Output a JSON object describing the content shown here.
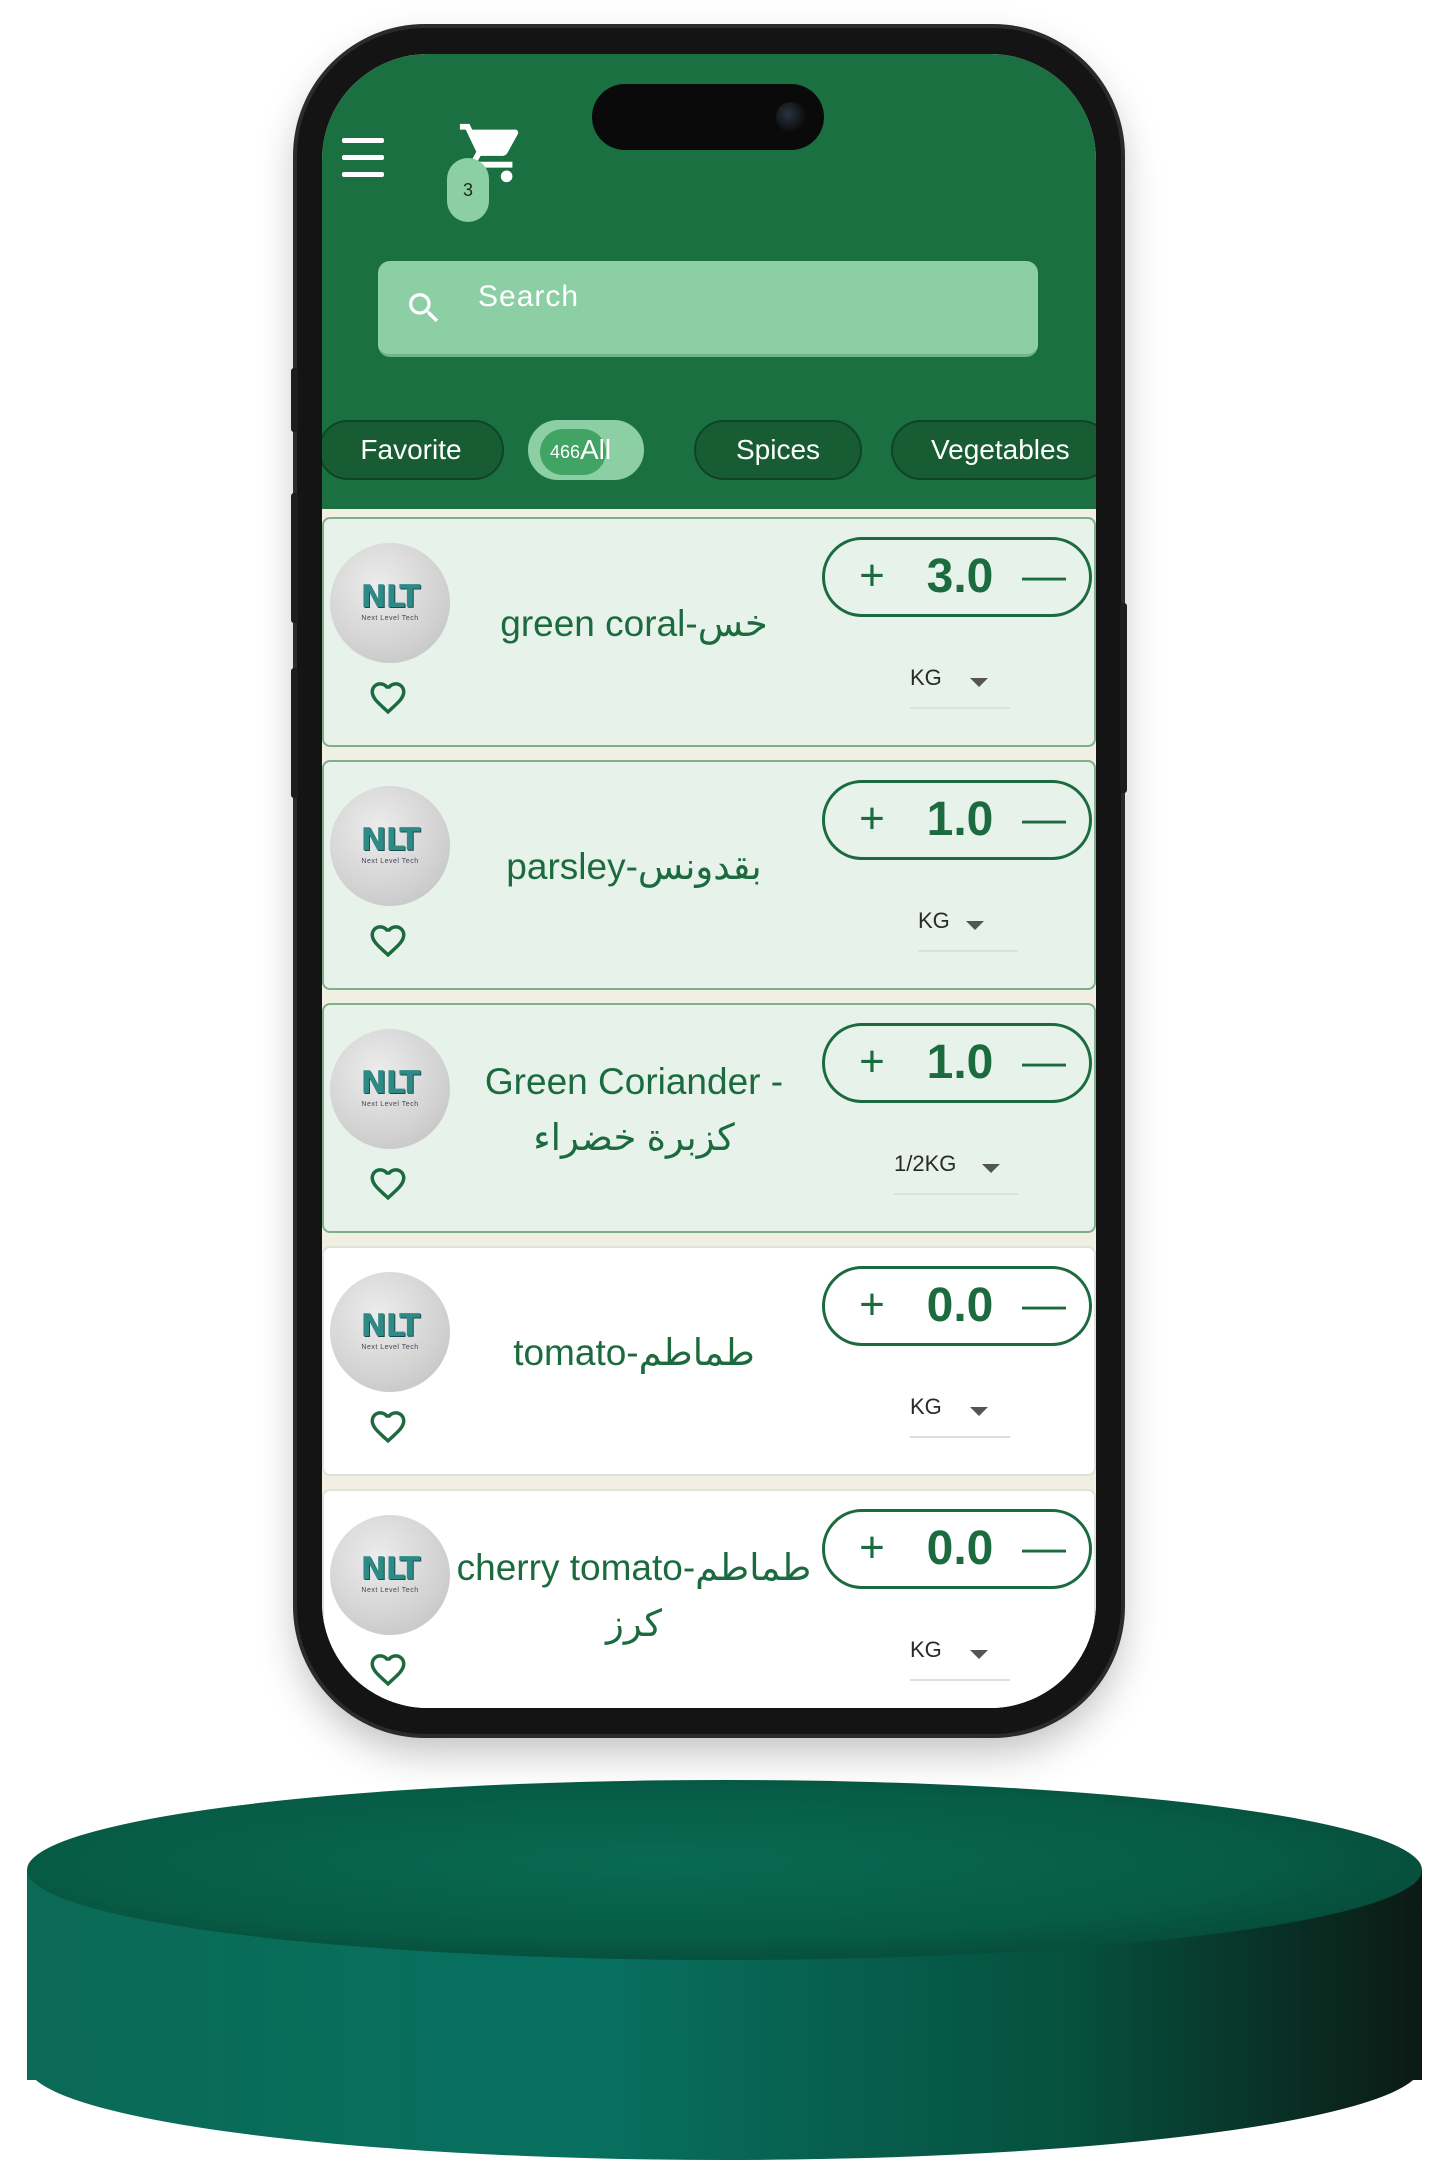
{
  "header": {
    "menu_icon": "hamburger-menu-icon",
    "cart_icon": "shopping-cart-icon",
    "cart_count": "3",
    "colors": {
      "header_bg": "#1a7040",
      "accent_light": "#8dcfa5",
      "text_green": "#1c6b3e"
    }
  },
  "search": {
    "icon": "search-icon",
    "placeholder": "Search",
    "value": ""
  },
  "categories": {
    "favorite": "Favorite",
    "all": "All",
    "all_count": "466",
    "spices": "Spices",
    "vegetables": "Vegetables"
  },
  "products": [
    {
      "name": "green coral-خس",
      "quantity": "3.0",
      "unit": "KG",
      "favorite_icon": "heart-outline-icon"
    },
    {
      "name": "parsley-بقدونس",
      "quantity": "1.0",
      "unit": "KG",
      "favorite_icon": "heart-outline-icon"
    },
    {
      "name": "Green Coriander - كزبرة خضراء",
      "quantity": "1.0",
      "unit": "1/2KG",
      "favorite_icon": "heart-outline-icon"
    },
    {
      "name": "tomato-طماطم",
      "quantity": "0.0",
      "unit": "KG",
      "favorite_icon": "heart-outline-icon"
    },
    {
      "name": "cherry tomato-طماطم كرز",
      "quantity": "0.0",
      "unit": "KG",
      "favorite_icon": "heart-outline-icon"
    }
  ],
  "logo": {
    "text": "NLT",
    "subtitle": "Next Level Tech"
  },
  "stepper": {
    "plus": "+",
    "minus": "—"
  }
}
